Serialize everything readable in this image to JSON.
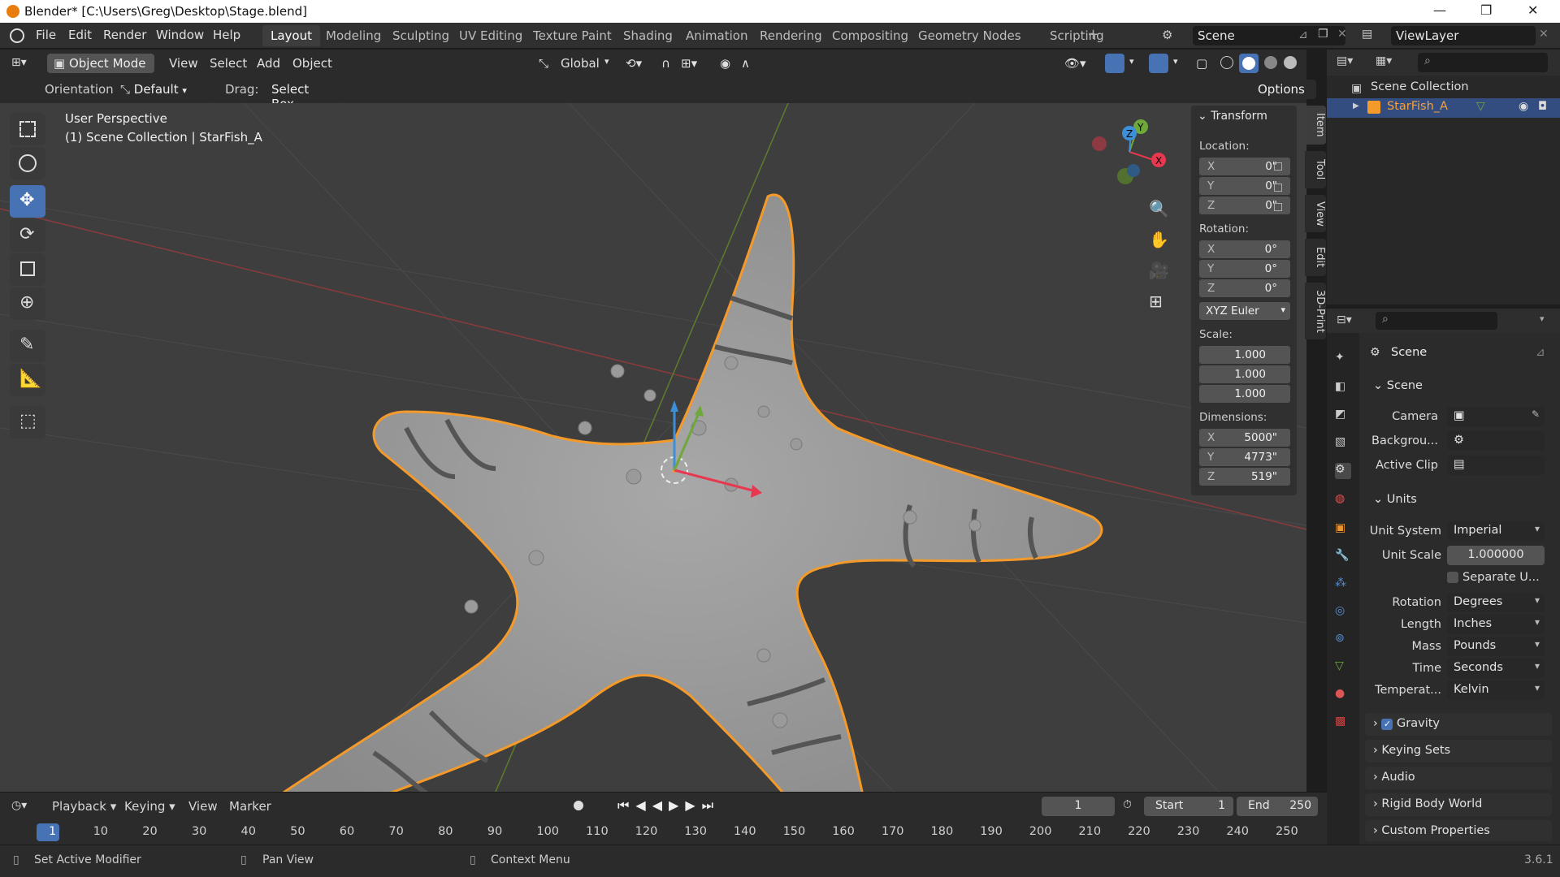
{
  "title": "Blender* [C:\\Users\\Greg\\Desktop\\Stage.blend]",
  "menu": [
    "File",
    "Edit",
    "Render",
    "Window",
    "Help"
  ],
  "workspaces": [
    "Layout",
    "Modeling",
    "Sculpting",
    "UV Editing",
    "Texture Paint",
    "Shading",
    "Animation",
    "Rendering",
    "Compositing",
    "Geometry Nodes",
    "Scripting"
  ],
  "active_workspace": "Layout",
  "scene_name": "Scene",
  "view_layer": "ViewLayer",
  "viewport_header": {
    "mode": "Object Mode",
    "menus": [
      "View",
      "Select",
      "Add",
      "Object"
    ],
    "transform_orientation": "Global"
  },
  "tool_settings": {
    "orientation_label": "Orientation:",
    "orientation_value": "Default",
    "drag_label": "Drag:",
    "drag_value": "Select Box",
    "options": "Options"
  },
  "viewport": {
    "perspective": "User Perspective",
    "context": "(1) Scene Collection | StarFish_A",
    "gizmo_axes": {
      "x": "X",
      "y": "Y",
      "z": "Z"
    },
    "axis_colors": {
      "x": "#e8384f",
      "y": "#6fa83a",
      "z": "#3d8fd8"
    },
    "selection_outline": "#f39a2a"
  },
  "n_panel": {
    "header": "Transform",
    "location_label": "Location:",
    "location": [
      {
        "axis": "X",
        "value": "0\""
      },
      {
        "axis": "Y",
        "value": "0\""
      },
      {
        "axis": "Z",
        "value": "0\""
      }
    ],
    "rotation_label": "Rotation:",
    "rotation": [
      {
        "axis": "X",
        "value": "0°"
      },
      {
        "axis": "Y",
        "value": "0°"
      },
      {
        "axis": "Z",
        "value": "0°"
      }
    ],
    "rotation_mode": "XYZ Euler",
    "scale_label": "Scale:",
    "scale": [
      "1.000",
      "1.000",
      "1.000"
    ],
    "dimensions_label": "Dimensions:",
    "dimensions": [
      {
        "axis": "X",
        "value": "5000\""
      },
      {
        "axis": "Y",
        "value": "4773\""
      },
      {
        "axis": "Z",
        "value": "519\""
      }
    ],
    "side_tabs": [
      "Item",
      "Tool",
      "View",
      "Edit",
      "3D-Print"
    ]
  },
  "outliner": {
    "root": "Scene Collection",
    "items": [
      {
        "name": "StarFish_A",
        "selected": true
      }
    ]
  },
  "properties": {
    "header": "Scene",
    "scene_section": "Scene",
    "camera_label": "Camera",
    "background_label": "Backgrou...",
    "active_clip_label": "Active Clip",
    "units_section": "Units",
    "unit_system_label": "Unit System",
    "unit_system": "Imperial",
    "unit_scale_label": "Unit Scale",
    "unit_scale": "1.000000",
    "separate_units": "Separate U...",
    "rotation_label": "Rotation",
    "rotation": "Degrees",
    "length_label": "Length",
    "length": "Inches",
    "mass_label": "Mass",
    "mass": "Pounds",
    "time_label": "Time",
    "time": "Seconds",
    "temperature_label": "Temperat...",
    "temperature": "Kelvin",
    "gravity": "Gravity",
    "gravity_checked": true,
    "collapsed_sections": [
      "Keying Sets",
      "Audio",
      "Rigid Body World",
      "Custom Properties"
    ]
  },
  "timeline": {
    "menus": [
      "Playback",
      "Keying",
      "View",
      "Marker"
    ],
    "current_frame": "1",
    "start_label": "Start",
    "start": "1",
    "end_label": "End",
    "end": "250",
    "ticks": [
      "1",
      "10",
      "20",
      "30",
      "40",
      "50",
      "60",
      "70",
      "80",
      "90",
      "100",
      "110",
      "120",
      "130",
      "140",
      "150",
      "160",
      "170",
      "180",
      "190",
      "200",
      "210",
      "220",
      "230",
      "240",
      "250"
    ]
  },
  "statusbar": {
    "items": [
      "Set Active Modifier",
      "Pan View",
      "Context Menu"
    ],
    "version": "3.6.1"
  }
}
